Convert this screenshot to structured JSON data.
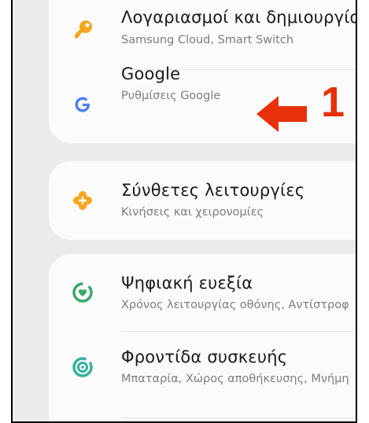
{
  "settings": {
    "items": [
      {
        "title": "Λογαριασμοί και δημιουργία",
        "subtitle": "Samsung Cloud, Smart Switch",
        "icon": "key-icon",
        "icon_color": "#f2a81d"
      },
      {
        "title": "Google",
        "subtitle": "Ρυθμίσεις Google",
        "icon": "google-g-icon",
        "icon_color": "#4a7ff0"
      },
      {
        "title": "Σύνθετες λειτουργίες",
        "subtitle": "Κινήσεις και χειρονομίες",
        "icon": "puzzle-plus-icon",
        "icon_color": "#f5a623"
      },
      {
        "title": "Ψηφιακή ευεξία",
        "subtitle": "Χρόνος λειτουργίας οθόνης, Αντίστροφ",
        "icon": "wellbeing-heart-icon",
        "icon_color": "#3aa76d"
      },
      {
        "title": "Φροντίδα συσκευής",
        "subtitle": "Μπαταρία, Χώρος αποθήκευσης, Μνήμη",
        "icon": "device-care-icon",
        "icon_color": "#34b3a0"
      }
    ]
  },
  "annotation": {
    "step_number": "1",
    "arrow_color": "#e8300a"
  }
}
